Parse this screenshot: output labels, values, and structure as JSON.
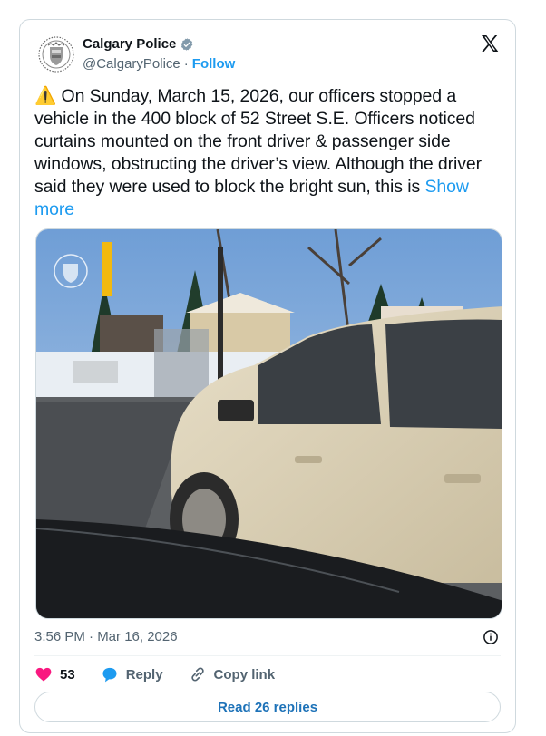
{
  "author": {
    "name": "Calgary Police",
    "handle": "@CalgaryPolice",
    "separator": "·",
    "follow_label": "Follow",
    "verified_icon": "verified-badge-icon",
    "avatar_icon": "police-crest-icon"
  },
  "platform_logo": "x-logo-icon",
  "post": {
    "warning_emoji": "⚠️",
    "body": "On Sunday, March 15, 2026, our officers stopped a vehicle in the 400 block of 52 Street S.E. Officers noticed curtains mounted on the front driver & passenger side windows, obstructing the driver’s view. Although the driver said they were used to block the bright sun, this is",
    "show_more": "Show more"
  },
  "timestamp": "3:56 PM · Mar 16, 2026",
  "actions": {
    "like_count": "53",
    "reply_label": "Reply",
    "copy_link_label": "Copy link"
  },
  "read_replies_label": "Read 26 replies",
  "colors": {
    "accent": "#1d9bf0",
    "like": "#f91880",
    "secondary_text": "#536471",
    "border": "#cfd9de"
  }
}
